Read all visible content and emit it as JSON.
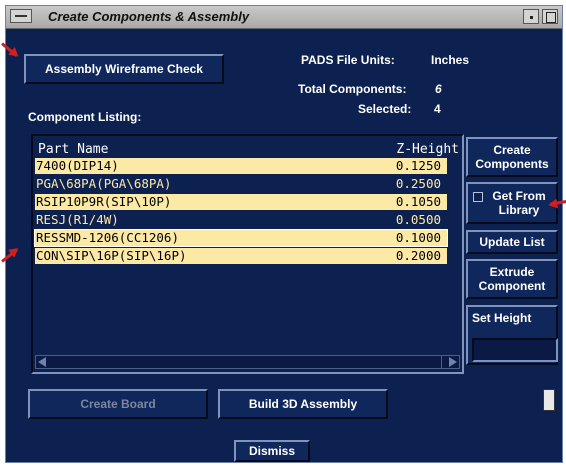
{
  "window": {
    "title": "Create Components & Assembly"
  },
  "buttons": {
    "wireframe_check": "Assembly Wireframe Check",
    "create_components": "Create Components",
    "get_from_library": "Get From Library",
    "update_list": "Update List",
    "extrude_component": "Extrude Component",
    "set_height": "Set Height",
    "create_board": "Create Board",
    "build_3d_assembly": "Build 3D Assembly",
    "dismiss": "Dismiss"
  },
  "info": {
    "units_label": "PADS File Units:",
    "units_value": "Inches",
    "total_label": "Total Components:",
    "total_value": "6",
    "selected_label": "Selected:",
    "selected_value": "4"
  },
  "listing": {
    "label": "Component Listing:",
    "col_part": "Part Name",
    "col_height": "Z-Height",
    "rows": [
      {
        "part": "7400(DIP14)",
        "height": "0.1250"
      },
      {
        "part": "PGA\\68PA(PGA\\68PA)",
        "height": "0.2500"
      },
      {
        "part": "RSIP10P9R(SIP\\10P)",
        "height": "0.1050"
      },
      {
        "part": "RESJ(R1/4W)",
        "height": "0.0500"
      },
      {
        "part": "RESSMD-1206(CC1206)",
        "height": "0.1000"
      },
      {
        "part": "CON\\SIP\\16P(SIP\\16P)",
        "height": "0.2000"
      }
    ]
  },
  "colors": {
    "background": "#0d2150",
    "row_highlight": "#fde9a6",
    "annotation_arrow": "#d41e1e"
  }
}
